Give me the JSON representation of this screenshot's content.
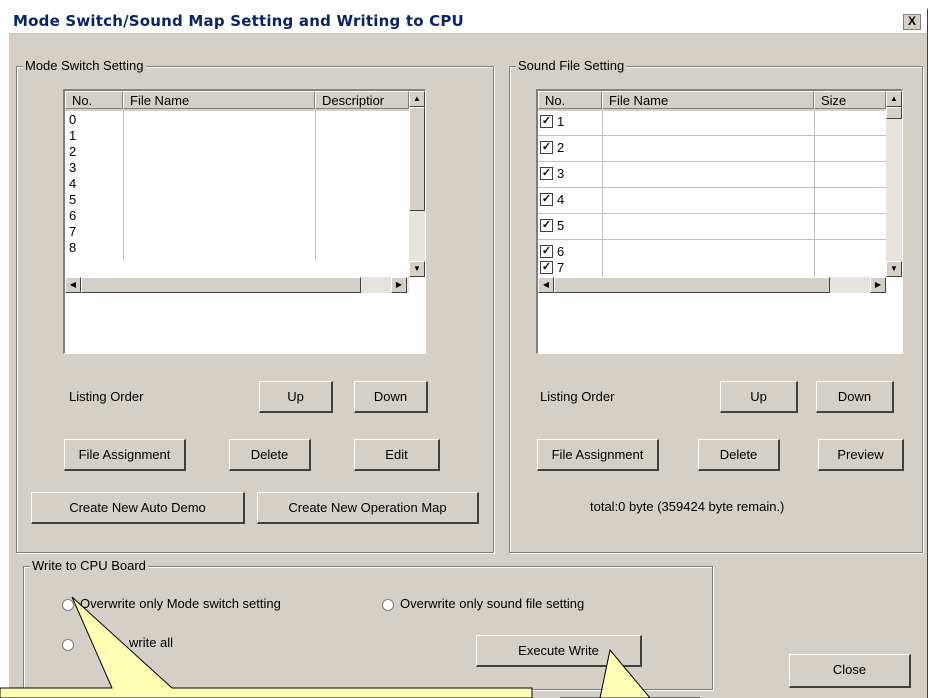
{
  "window": {
    "title": "Mode Switch/Sound Map Setting and Writing to CPU",
    "close_glyph": "X"
  },
  "mode_switch": {
    "group_label": "Mode Switch Setting",
    "columns": [
      "No.",
      "File Name",
      "Descriptior"
    ],
    "rows": [
      "0",
      "1",
      "2",
      "3",
      "4",
      "5",
      "6",
      "7",
      "8"
    ],
    "listing_order_label": "Listing Order",
    "up": "Up",
    "down": "Down",
    "file_assignment": "File Assignment",
    "delete": "Delete",
    "edit": "Edit",
    "create_auto_demo": "Create New Auto Demo",
    "create_operation_map": "Create New Operation Map"
  },
  "sound_file": {
    "group_label": "Sound File Setting",
    "columns": [
      "No.",
      "File Name",
      "Size"
    ],
    "rows": [
      {
        "no": "1",
        "checked": true
      },
      {
        "no": "2",
        "checked": true
      },
      {
        "no": "3",
        "checked": true
      },
      {
        "no": "4",
        "checked": true
      },
      {
        "no": "5",
        "checked": true
      },
      {
        "no": "6",
        "checked": true
      },
      {
        "no": "7",
        "checked": true
      }
    ],
    "check_glyph": "✓",
    "listing_order_label": "Listing Order",
    "up": "Up",
    "down": "Down",
    "file_assignment": "File Assignment",
    "delete": "Delete",
    "preview": "Preview",
    "total": "total:0 byte  (359424 byte remain.)"
  },
  "write_cpu": {
    "group_label": "Write to CPU Board",
    "opt_mode": "Overwrite only Mode switch setting",
    "opt_sound": "Overwrite only sound file setting",
    "opt_all": "write all",
    "execute": "Execute Write"
  },
  "close": "Close",
  "icons": {
    "scroll_up": "▲",
    "scroll_down": "▼",
    "scroll_left": "◀",
    "scroll_right": "▶"
  },
  "colors": {
    "callout_fill": "#ffffb4",
    "face": "#d4d0c8",
    "title_text": "#0a246a"
  }
}
